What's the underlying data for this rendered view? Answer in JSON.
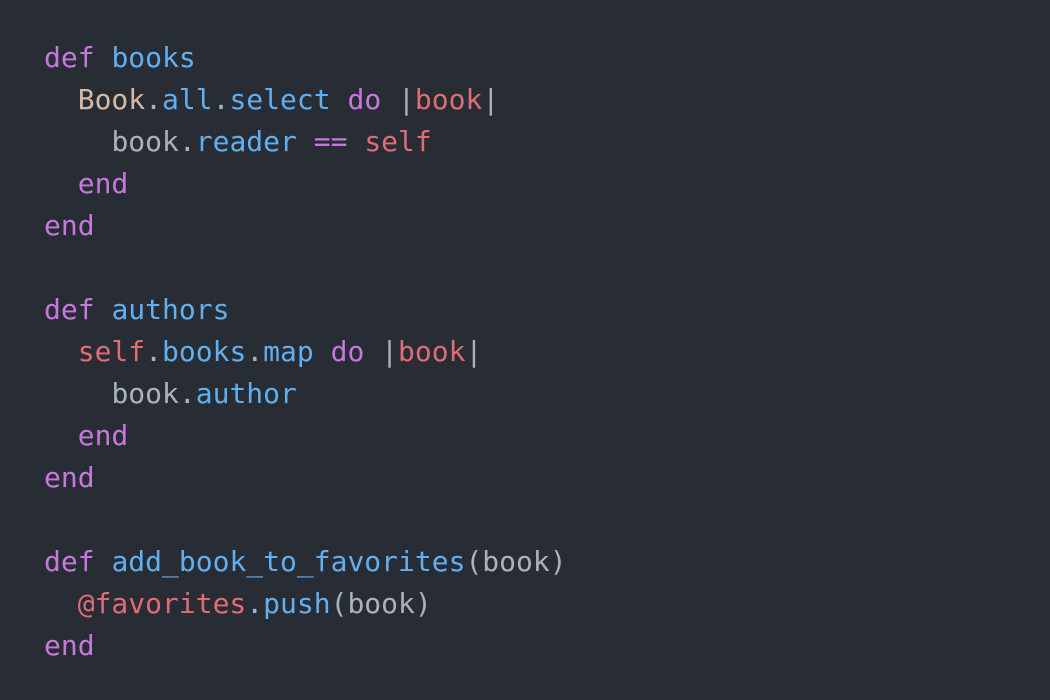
{
  "colors": {
    "background": "#282c34",
    "keyword": "#c678dd",
    "function": "#61afef",
    "plain": "#abb2bf",
    "constant": "#d7b9a6",
    "variable": "#e06c75"
  },
  "lines": [
    [
      {
        "t": "def",
        "c": "keyword"
      },
      {
        "t": " ",
        "c": "plain"
      },
      {
        "t": "books",
        "c": "function"
      }
    ],
    [
      {
        "t": "  ",
        "c": "plain"
      },
      {
        "t": "Book",
        "c": "constant"
      },
      {
        "t": ".",
        "c": "plain"
      },
      {
        "t": "all",
        "c": "function"
      },
      {
        "t": ".",
        "c": "plain"
      },
      {
        "t": "select",
        "c": "function"
      },
      {
        "t": " ",
        "c": "plain"
      },
      {
        "t": "do",
        "c": "keyword"
      },
      {
        "t": " |",
        "c": "plain"
      },
      {
        "t": "book",
        "c": "variable"
      },
      {
        "t": "|",
        "c": "plain"
      }
    ],
    [
      {
        "t": "    ",
        "c": "plain"
      },
      {
        "t": "book",
        "c": "plain"
      },
      {
        "t": ".",
        "c": "plain"
      },
      {
        "t": "reader",
        "c": "function"
      },
      {
        "t": " ",
        "c": "plain"
      },
      {
        "t": "==",
        "c": "keyword"
      },
      {
        "t": " ",
        "c": "plain"
      },
      {
        "t": "self",
        "c": "variable"
      }
    ],
    [
      {
        "t": "  ",
        "c": "plain"
      },
      {
        "t": "end",
        "c": "keyword"
      }
    ],
    [
      {
        "t": "end",
        "c": "keyword"
      }
    ],
    [],
    [
      {
        "t": "def",
        "c": "keyword"
      },
      {
        "t": " ",
        "c": "plain"
      },
      {
        "t": "authors",
        "c": "function"
      }
    ],
    [
      {
        "t": "  ",
        "c": "plain"
      },
      {
        "t": "self",
        "c": "variable"
      },
      {
        "t": ".",
        "c": "plain"
      },
      {
        "t": "books",
        "c": "function"
      },
      {
        "t": ".",
        "c": "plain"
      },
      {
        "t": "map",
        "c": "function"
      },
      {
        "t": " ",
        "c": "plain"
      },
      {
        "t": "do",
        "c": "keyword"
      },
      {
        "t": " |",
        "c": "plain"
      },
      {
        "t": "book",
        "c": "variable"
      },
      {
        "t": "|",
        "c": "plain"
      }
    ],
    [
      {
        "t": "    ",
        "c": "plain"
      },
      {
        "t": "book",
        "c": "plain"
      },
      {
        "t": ".",
        "c": "plain"
      },
      {
        "t": "author",
        "c": "function"
      }
    ],
    [
      {
        "t": "  ",
        "c": "plain"
      },
      {
        "t": "end",
        "c": "keyword"
      }
    ],
    [
      {
        "t": "end",
        "c": "keyword"
      }
    ],
    [],
    [
      {
        "t": "def",
        "c": "keyword"
      },
      {
        "t": " ",
        "c": "plain"
      },
      {
        "t": "add_book_to_favorites",
        "c": "function"
      },
      {
        "t": "(book)",
        "c": "plain"
      }
    ],
    [
      {
        "t": "  ",
        "c": "plain"
      },
      {
        "t": "@favorites",
        "c": "variable"
      },
      {
        "t": ".",
        "c": "plain"
      },
      {
        "t": "push",
        "c": "function"
      },
      {
        "t": "(book)",
        "c": "plain"
      }
    ],
    [
      {
        "t": "end",
        "c": "keyword"
      }
    ]
  ]
}
